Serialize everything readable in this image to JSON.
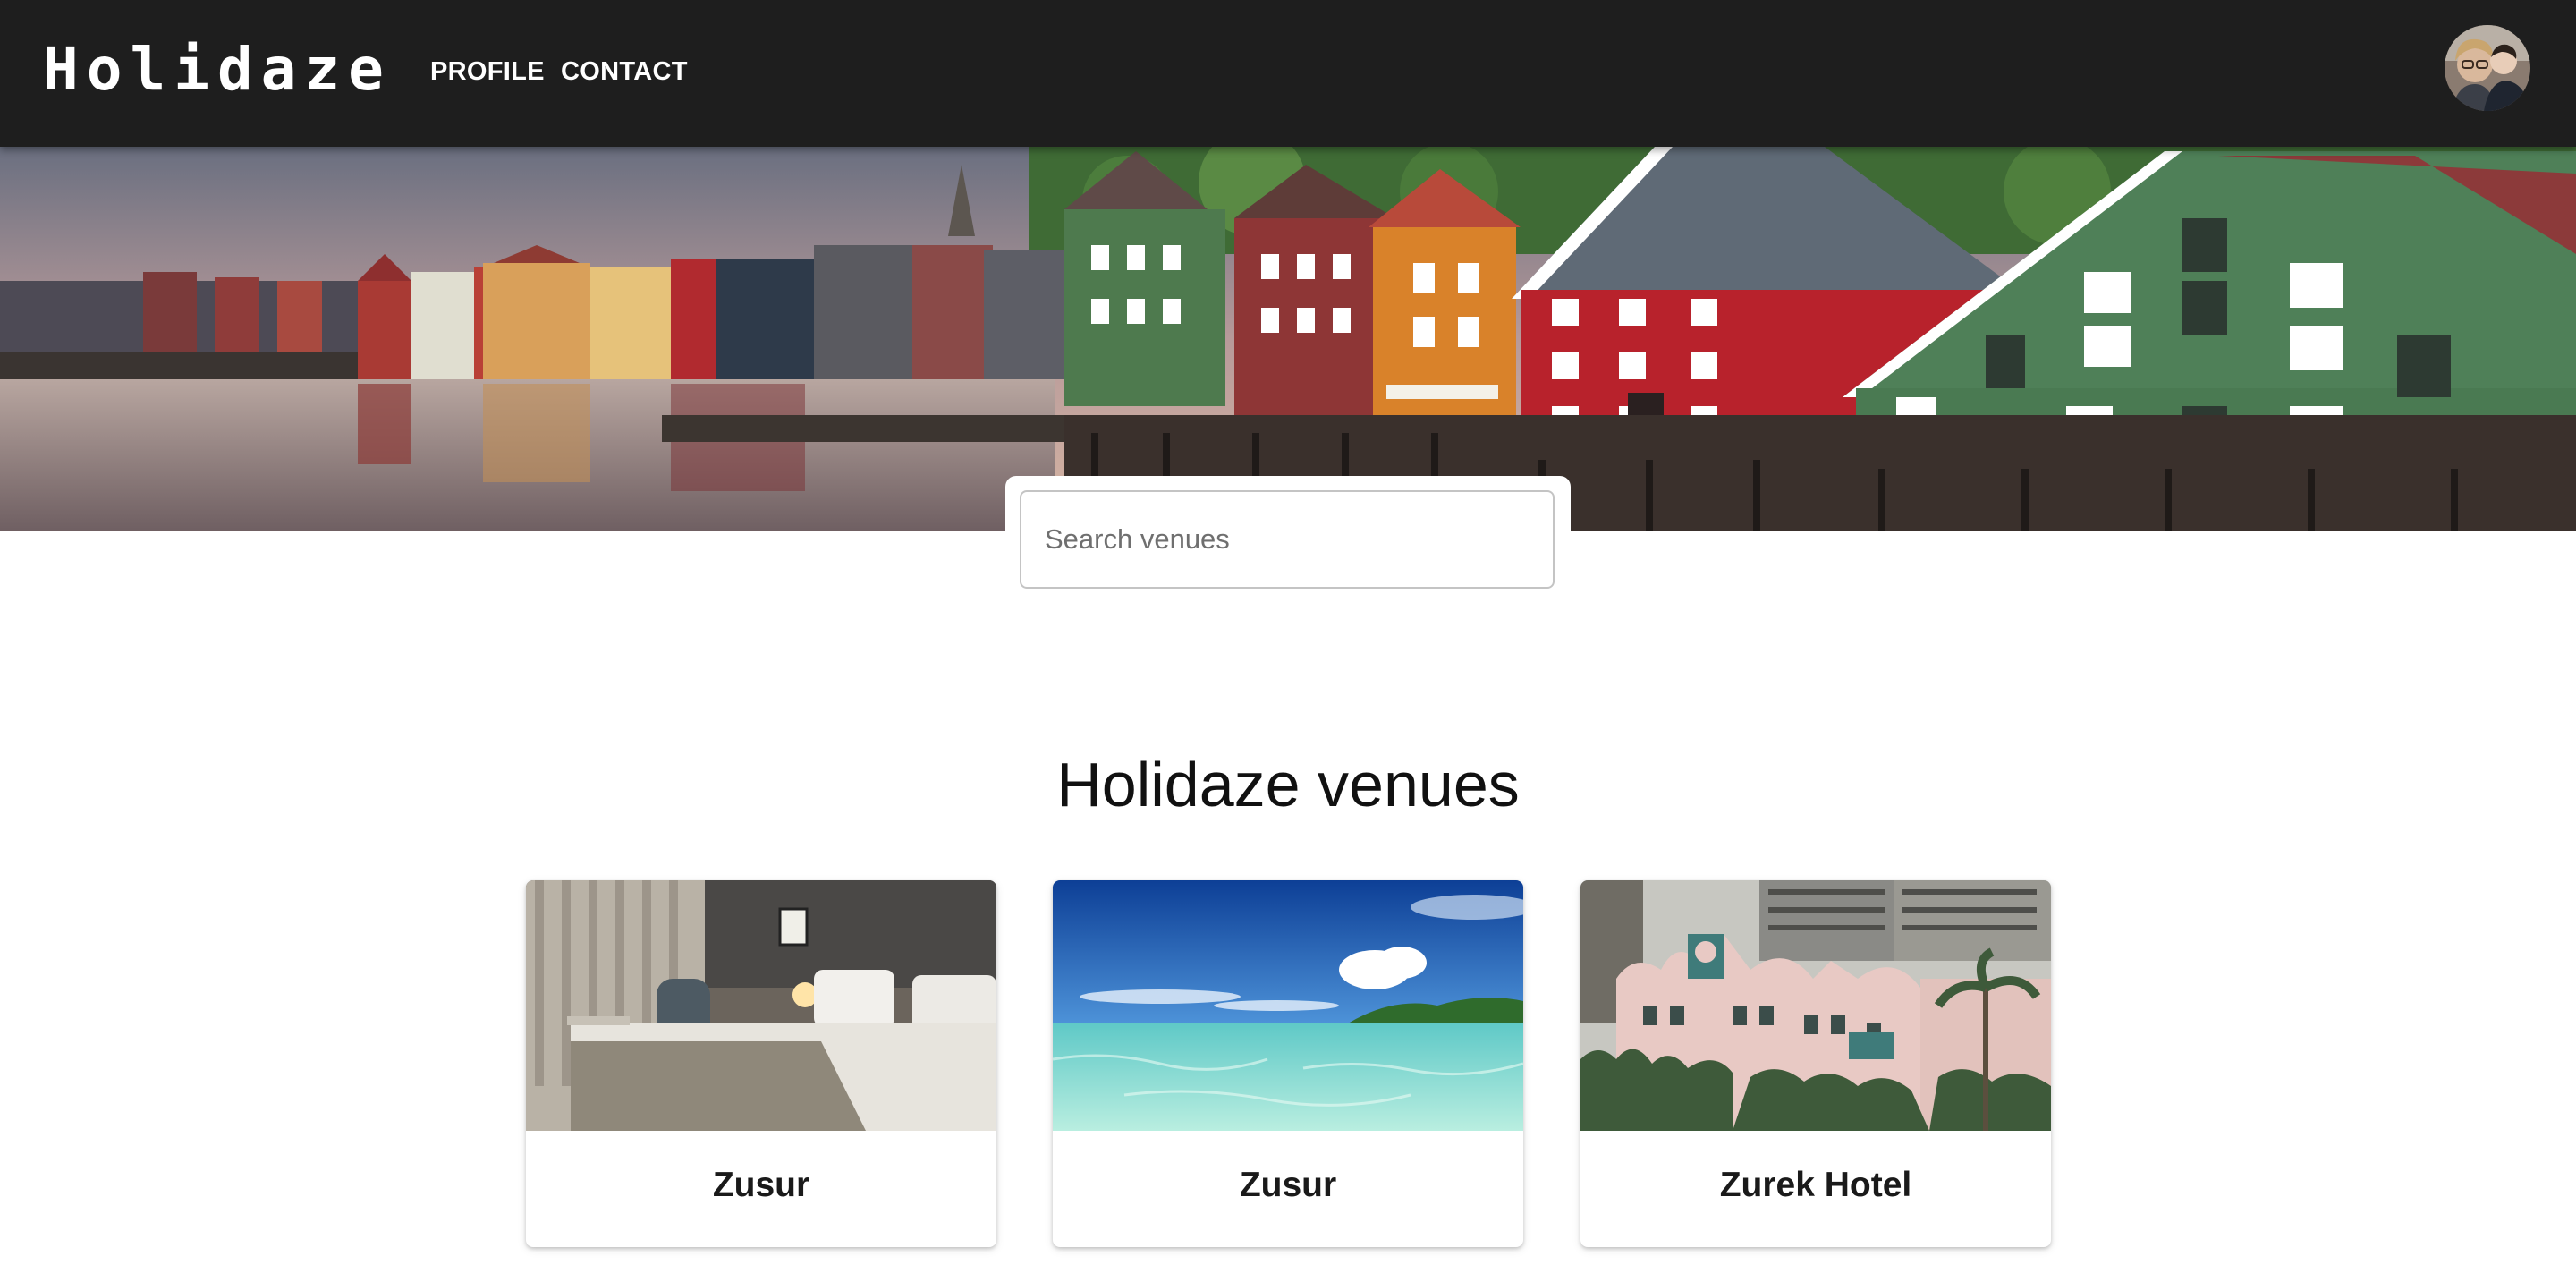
{
  "header": {
    "logo": "Holidaze",
    "nav": [
      {
        "label": "PROFILE"
      },
      {
        "label": "CONTACT"
      }
    ],
    "avatar_icon": "user-avatar"
  },
  "search": {
    "placeholder": "Search venues",
    "value": ""
  },
  "main": {
    "title": "Holidaze venues",
    "venues": [
      {
        "name": "Zusur",
        "image": "hotel-bedroom"
      },
      {
        "name": "Zusur",
        "image": "tropical-beach"
      },
      {
        "name": "Zurek Hotel",
        "image": "pink-hotel-facade"
      }
    ]
  },
  "colors": {
    "header_bg": "#1e1e1e",
    "page_bg": "#ffffff",
    "text": "#111111"
  }
}
